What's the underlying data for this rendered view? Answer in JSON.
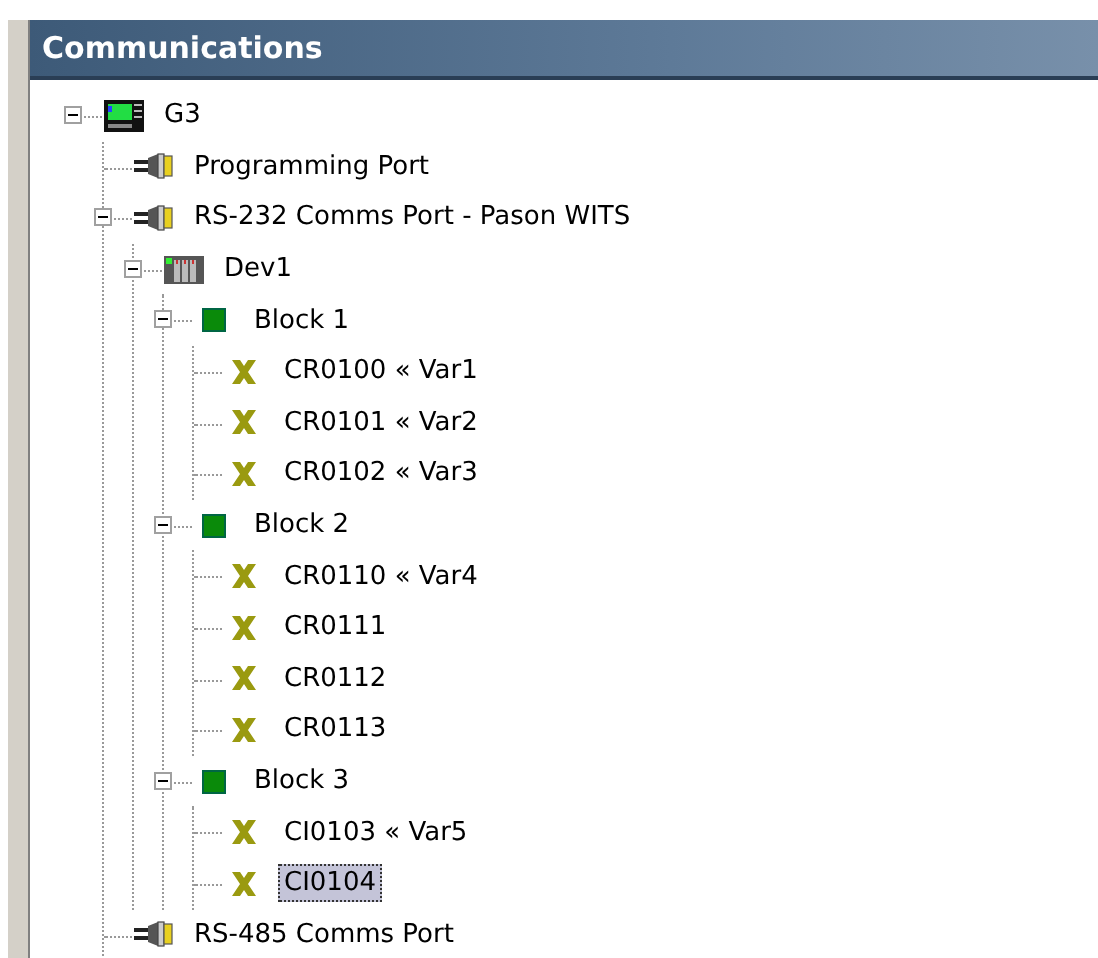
{
  "panel": {
    "title": "Communications"
  },
  "tree": [
    {
      "label": "G3",
      "kind": "device",
      "expanded": true,
      "selected": false,
      "children": [
        {
          "label": "Programming Port",
          "kind": "port",
          "selected": false
        },
        {
          "label": "RS-232 Comms Port - Pason WITS",
          "kind": "port",
          "expanded": true,
          "selected": false,
          "children": [
            {
              "label": "Dev1",
              "kind": "rack",
              "expanded": true,
              "selected": false,
              "children": [
                {
                  "label": "Block 1",
                  "kind": "block",
                  "expanded": true,
                  "selected": false,
                  "children": [
                    {
                      "label": "CR0100 « Var1",
                      "kind": "tag",
                      "selected": false
                    },
                    {
                      "label": "CR0101 « Var2",
                      "kind": "tag",
                      "selected": false
                    },
                    {
                      "label": "CR0102 « Var3",
                      "kind": "tag",
                      "selected": false
                    }
                  ]
                },
                {
                  "label": "Block 2",
                  "kind": "block",
                  "expanded": true,
                  "selected": false,
                  "children": [
                    {
                      "label": "CR0110 « Var4",
                      "kind": "tag",
                      "selected": false
                    },
                    {
                      "label": "CR0111",
                      "kind": "tag",
                      "selected": false
                    },
                    {
                      "label": "CR0112",
                      "kind": "tag",
                      "selected": false
                    },
                    {
                      "label": "CR0113",
                      "kind": "tag",
                      "selected": false
                    }
                  ]
                },
                {
                  "label": "Block 3",
                  "kind": "block",
                  "expanded": true,
                  "selected": false,
                  "children": [
                    {
                      "label": "CI0103 « Var5",
                      "kind": "tag",
                      "selected": false
                    },
                    {
                      "label": "CI0104",
                      "kind": "tag",
                      "selected": true
                    }
                  ]
                }
              ]
            }
          ]
        },
        {
          "label": "RS-485 Comms Port",
          "kind": "port",
          "selected": false
        }
      ]
    }
  ]
}
